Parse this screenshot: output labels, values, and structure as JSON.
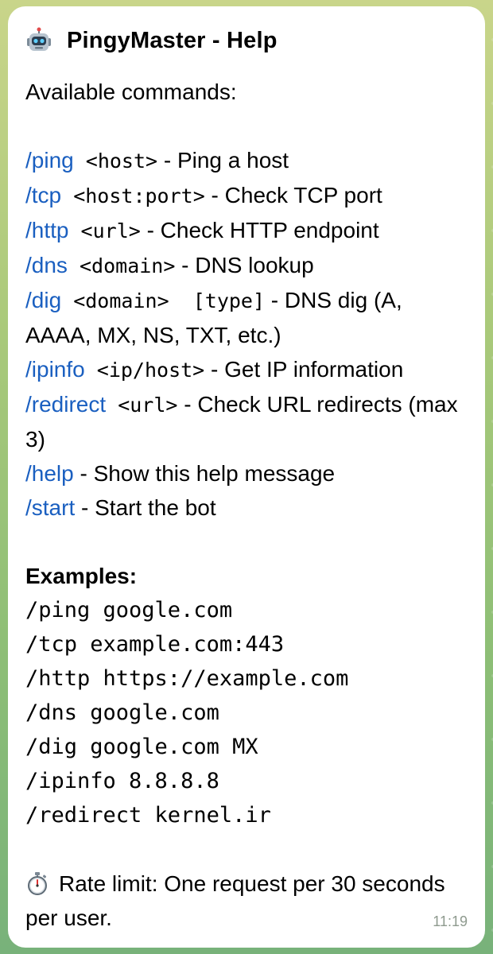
{
  "message": {
    "title_icon": "robot-icon",
    "title": "PingyMaster - Help",
    "intro": "Available commands:",
    "commands": [
      {
        "cmd": "/ping",
        "arg": " <host>",
        "desc": " - Ping a host"
      },
      {
        "cmd": "/tcp",
        "arg": " <host:port>",
        "desc": " - Check TCP port"
      },
      {
        "cmd": "/http",
        "arg": " <url>",
        "desc": " - Check HTTP endpoint"
      },
      {
        "cmd": "/dns",
        "arg": " <domain>",
        "desc": " - DNS lookup"
      },
      {
        "cmd": "/dig",
        "arg": " <domain>  [type]",
        "desc": " - DNS dig (A, AAAA, MX, NS, TXT, etc.)"
      },
      {
        "cmd": "/ipinfo",
        "arg": " <ip/host>",
        "desc": " - Get IP information"
      },
      {
        "cmd": "/redirect",
        "arg": " <url>",
        "desc": " - Check URL redirects (max 3)"
      },
      {
        "cmd": "/help",
        "arg": "",
        "desc": " - Show this help message"
      },
      {
        "cmd": "/start",
        "arg": "",
        "desc": " - Start the bot"
      }
    ],
    "examples_title": "Examples:",
    "examples": [
      "/ping google.com",
      "/tcp example.com:443",
      "/http https://example.com",
      "/dns google.com",
      "/dig google.com MX",
      "/ipinfo 8.8.8.8",
      "/redirect kernel.ir"
    ],
    "rate_icon": "stopwatch-icon",
    "rate_limit": "Rate limit: One request per 30 seconds per user.",
    "time": "11:19"
  }
}
